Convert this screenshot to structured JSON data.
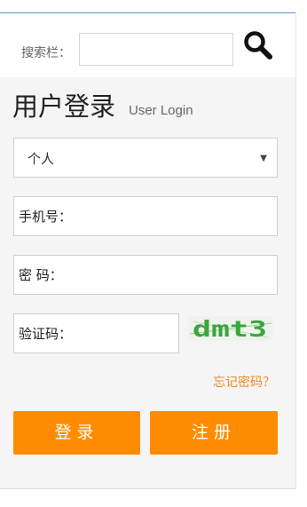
{
  "search": {
    "label": "搜索栏：",
    "value": ""
  },
  "login": {
    "title": "用户登录",
    "subtitle": "User Login",
    "account_type": {
      "selected": "个人"
    },
    "phone_label": "手机号：",
    "password_label": "密 码：",
    "captcha_label": "验证码：",
    "captcha_image_text": "dmt3",
    "forgot_password": "忘记密码？",
    "login_button": "登录",
    "register_button": "注册"
  },
  "colors": {
    "accent": "#ff8c00",
    "link": "#f08a24",
    "captcha_text": "#3aa63a"
  },
  "icons": {
    "search": "search-icon",
    "dropdown": "triangle-down"
  }
}
